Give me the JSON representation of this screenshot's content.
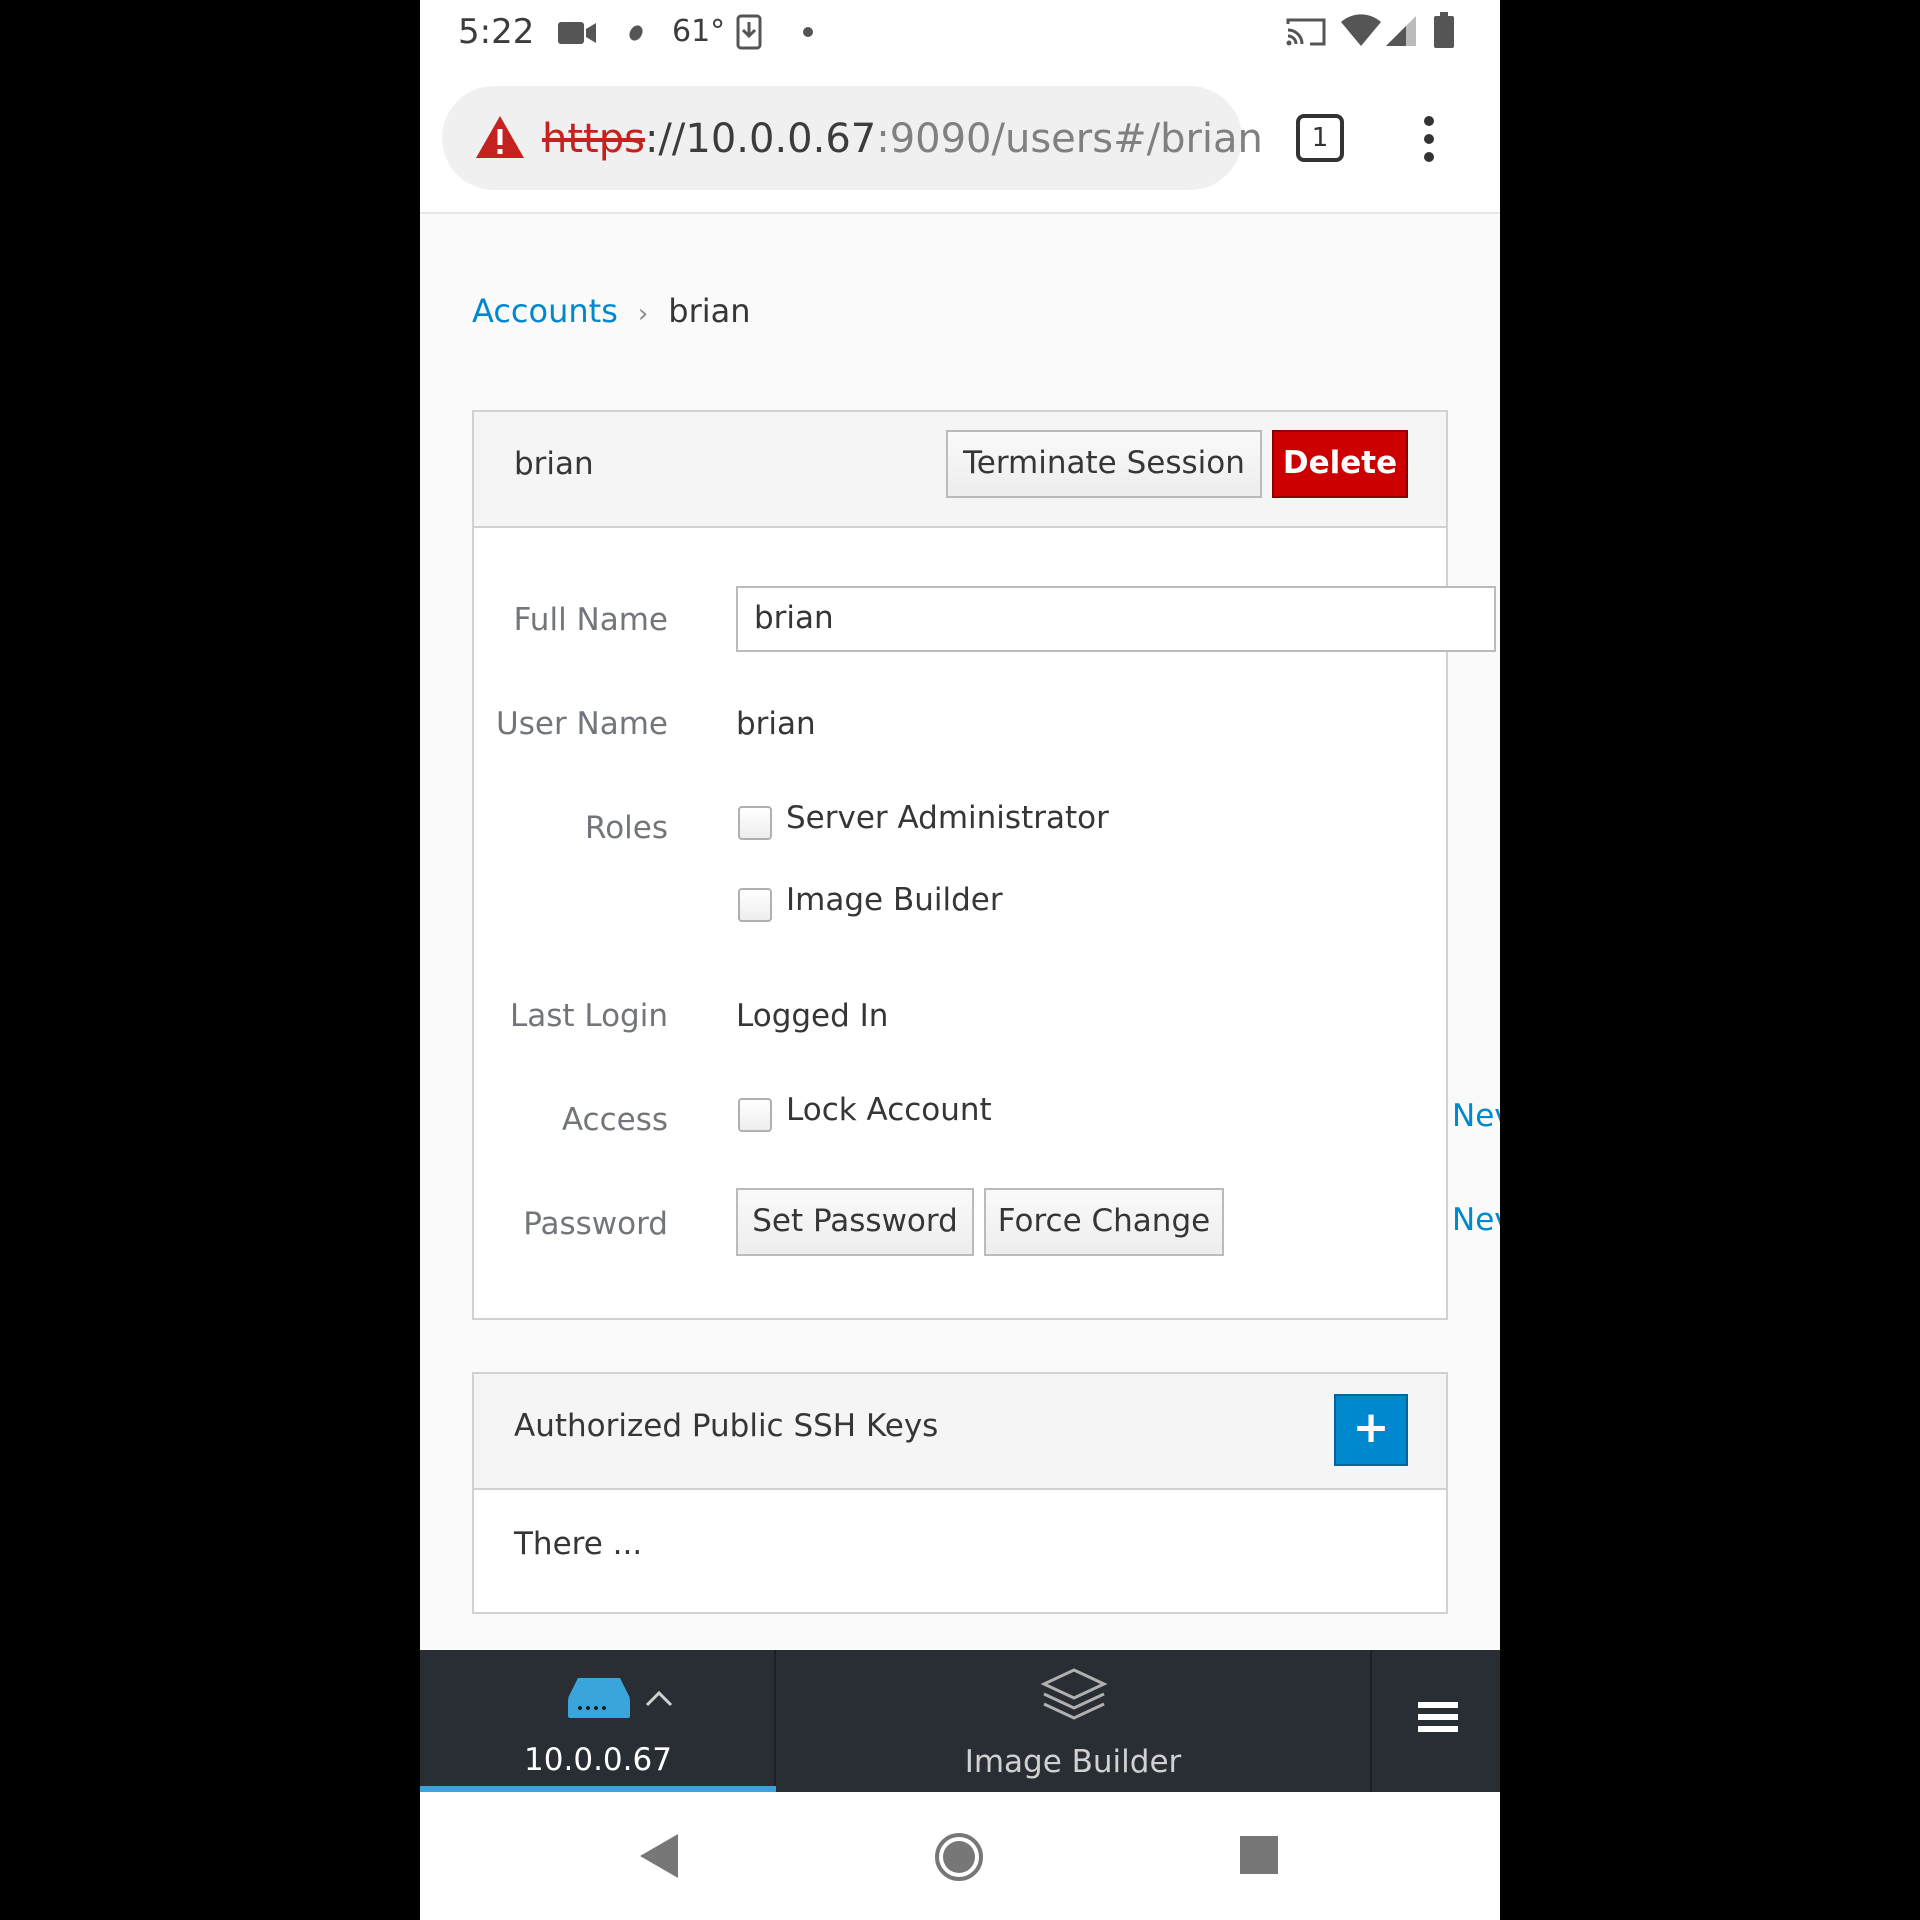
{
  "status_bar": {
    "time": "5:22",
    "temperature": "61°"
  },
  "browser": {
    "url_scheme": "https",
    "url_host": "://10.0.0.67",
    "url_rest": ":9090/users#/brian",
    "tab_count": "1"
  },
  "breadcrumb": {
    "parent": "Accounts",
    "separator": "›",
    "current": "brian"
  },
  "account_panel": {
    "title": "brian",
    "terminate_label": "Terminate Session",
    "delete_label": "Delete",
    "fields": {
      "full_name_label": "Full Name",
      "full_name_value": "brian",
      "user_name_label": "User Name",
      "user_name_value": "brian",
      "roles_label": "Roles",
      "role_1": "Server Administrator",
      "role_2": "Image Builder",
      "last_login_label": "Last Login",
      "last_login_value": "Logged In",
      "access_label": "Access",
      "lock_account": "Lock Account",
      "password_label": "Password",
      "set_password": "Set Password",
      "force_change": "Force Change",
      "side_link_1": "Nev",
      "side_link_2": "Nev"
    }
  },
  "ssh_panel": {
    "title": "Authorized Public SSH Keys",
    "add_label": "+",
    "body_text": "There ..."
  },
  "bottom_nav": {
    "host": "10.0.0.67",
    "image_builder": "Image Builder"
  },
  "colors": {
    "link": "#0088ce",
    "danger": "#cc0000",
    "primary": "#0088ce",
    "nav_bg": "#292e34",
    "nav_active": "#39a5dc"
  }
}
